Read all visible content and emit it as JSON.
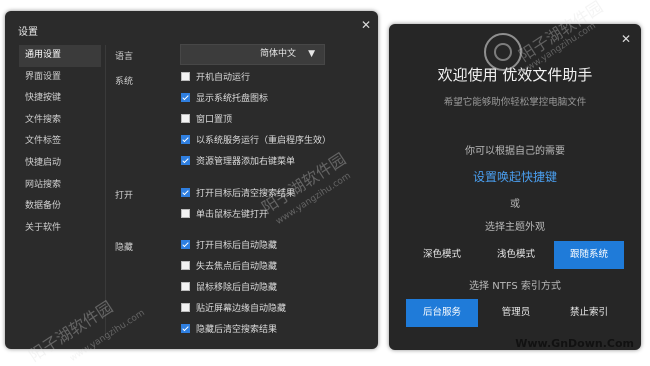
{
  "settings": {
    "title": "设置",
    "close": "✕",
    "sidebar": [
      {
        "label": "通用设置",
        "active": true
      },
      {
        "label": "界面设置"
      },
      {
        "label": "快捷按键"
      },
      {
        "label": "文件搜索"
      },
      {
        "label": "文件标签"
      },
      {
        "label": "快捷启动"
      },
      {
        "label": "网站搜索"
      },
      {
        "label": "数据备份"
      },
      {
        "label": "关于软件"
      }
    ],
    "language_label": "语言",
    "language_value": "简体中文",
    "section_system": "系统",
    "section_open": "打开",
    "section_hide": "隐藏",
    "options": [
      {
        "label": "开机自动运行",
        "checked": false
      },
      {
        "label": "显示系统托盘图标",
        "checked": true
      },
      {
        "label": "窗口置顶",
        "checked": false
      },
      {
        "label": "以系统服务运行（重启程序生效）",
        "checked": true
      },
      {
        "label": "资源管理器添加右键菜单",
        "checked": true
      },
      {
        "label": "打开目标后清空搜索结果",
        "checked": true
      },
      {
        "label": "单击鼠标左键打开",
        "checked": false
      },
      {
        "label": "打开目标后自动隐藏",
        "checked": true
      },
      {
        "label": "失去焦点后自动隐藏",
        "checked": false
      },
      {
        "label": "鼠标移除后自动隐藏",
        "checked": false
      },
      {
        "label": "贴近屏幕边缘自动隐藏",
        "checked": false
      },
      {
        "label": "隐藏后清空搜索结果",
        "checked": true
      }
    ]
  },
  "welcome": {
    "close": "✕",
    "title": "欢迎使用 优效文件助手",
    "subtitle": "希望它能够助你轻松掌控电脑文件",
    "need_text": "你可以根据自己的需要",
    "hotkey_link": "设置唤起快捷键",
    "or_text": "或",
    "theme_text": "选择主题外观",
    "theme_buttons": [
      "深色模式",
      "浅色模式",
      "跟随系统"
    ],
    "ntfs_text": "选择 NTFS 索引方式",
    "index_buttons": [
      "后台服务",
      "管理员",
      "禁止索引"
    ],
    "accent_color": "#1f7bd9",
    "link_color": "#4a9ff0"
  },
  "watermarks": {
    "name": "阳子湖软件园",
    "url": "www.yangzihu.com",
    "footer": "Www.GnDown.Com"
  }
}
